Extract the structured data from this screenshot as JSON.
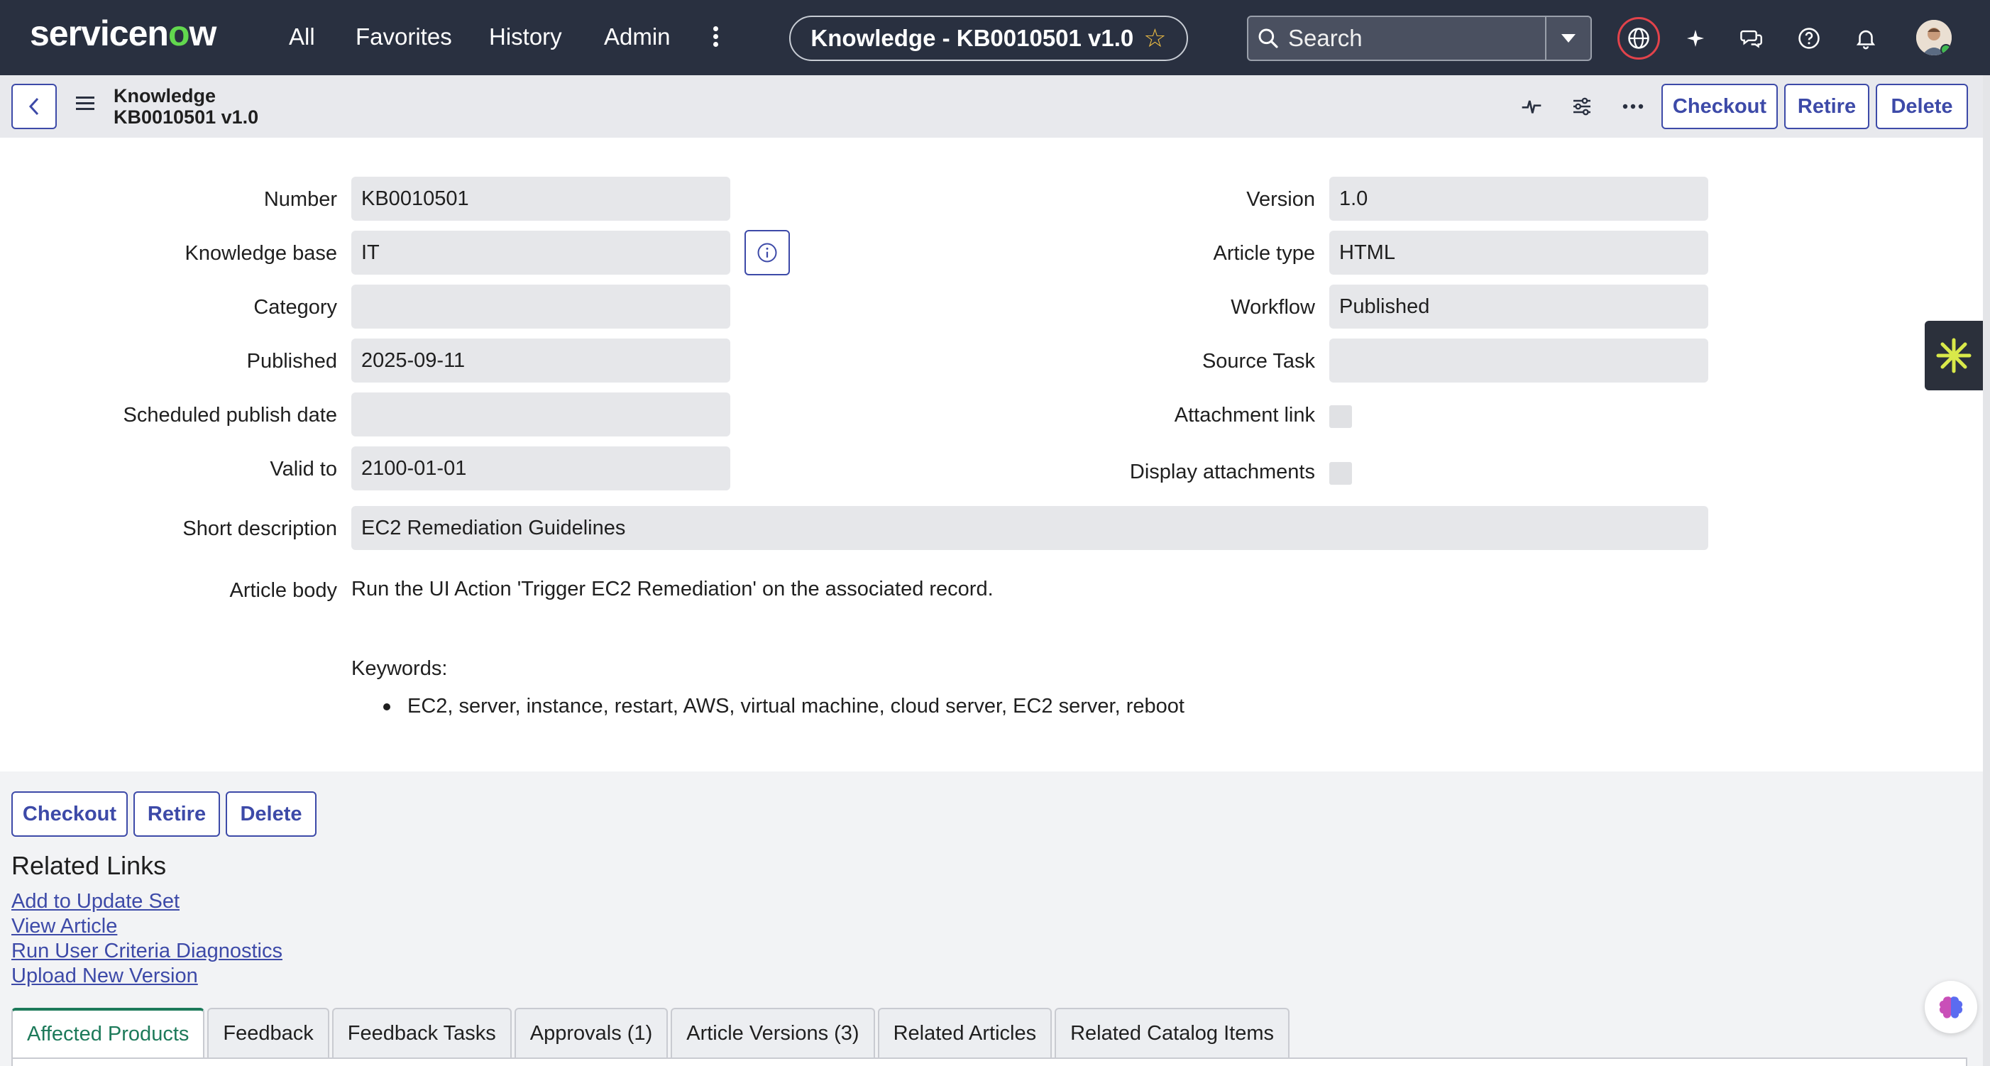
{
  "nav": {
    "logo_left": "servicen",
    "logo_o": "o",
    "logo_right": "w",
    "items": [
      "All",
      "Favorites",
      "History",
      "Admin"
    ],
    "record_title": "Knowledge - KB0010501 v1.0",
    "search_placeholder": "Search",
    "icons": [
      "globe-icon",
      "sparkle-icon",
      "chat-icon",
      "help-icon",
      "bell-icon",
      "user-avatar"
    ]
  },
  "header": {
    "breadcrumb_table": "Knowledge",
    "breadcrumb_record": "KB0010501 v1.0",
    "buttons": {
      "checkout": "Checkout",
      "retire": "Retire",
      "delete": "Delete"
    }
  },
  "form": {
    "left": [
      {
        "label": "Number",
        "value": "KB0010501"
      },
      {
        "label": "Knowledge base",
        "value": "IT"
      },
      {
        "label": "Category",
        "value": ""
      },
      {
        "label": "Published",
        "value": "2025-09-11"
      },
      {
        "label": "Scheduled publish date",
        "value": ""
      },
      {
        "label": "Valid to",
        "value": "2100-01-01"
      }
    ],
    "right": [
      {
        "label": "Version",
        "value": "1.0"
      },
      {
        "label": "Article type",
        "value": "HTML"
      },
      {
        "label": "Workflow",
        "value": "Published"
      },
      {
        "label": "Source Task",
        "value": ""
      },
      {
        "label": "Attachment link",
        "checked": false
      },
      {
        "label": "Display attachments",
        "checked": false
      }
    ],
    "short_description": {
      "label": "Short description",
      "value": "EC2 Remediation Guidelines"
    },
    "article_body": {
      "label": "Article body",
      "text": "Run the UI Action 'Trigger EC2 Remediation' on the associated record.",
      "keywords_heading": "Keywords:",
      "keywords": "EC2, server, instance, restart, AWS, virtual machine, cloud server, EC2 server, reboot"
    }
  },
  "bottom_buttons": {
    "checkout": "Checkout",
    "retire": "Retire",
    "delete": "Delete"
  },
  "related_links": {
    "title": "Related Links",
    "links": [
      "Add to Update Set",
      "View Article",
      "Run User Criteria Diagnostics",
      "Upload New Version"
    ]
  },
  "tabs": [
    "Affected Products",
    "Feedback",
    "Feedback Tasks",
    "Approvals (1)",
    "Article Versions (3)",
    "Related Articles",
    "Related Catalog Items"
  ],
  "colors": {
    "nav_bg": "#293040",
    "accent": "#3d4aa8",
    "active_tab": "#1d7a5a",
    "brand_green": "#62d84e"
  }
}
